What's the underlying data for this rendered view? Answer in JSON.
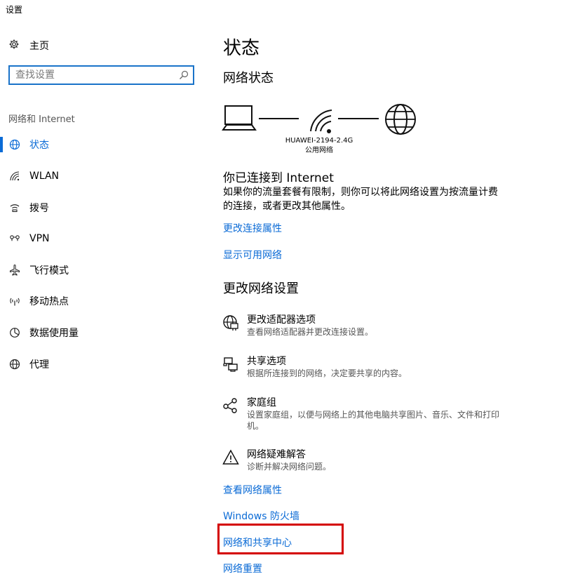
{
  "window": {
    "title": "设置"
  },
  "sidebar": {
    "home_label": "主页",
    "search_placeholder": "查找设置",
    "section_label": "网络和 Internet",
    "items": [
      {
        "label": "状态",
        "icon": "globe-status-icon",
        "active": true
      },
      {
        "label": "WLAN",
        "icon": "wifi-icon"
      },
      {
        "label": "拨号",
        "icon": "dialup-icon"
      },
      {
        "label": "VPN",
        "icon": "vpn-icon"
      },
      {
        "label": "飞行模式",
        "icon": "airplane-icon"
      },
      {
        "label": "移动热点",
        "icon": "hotspot-icon"
      },
      {
        "label": "数据使用量",
        "icon": "data-usage-icon"
      },
      {
        "label": "代理",
        "icon": "globe-icon"
      }
    ]
  },
  "main": {
    "title": "状态",
    "network_status_heading": "网络状态",
    "network": {
      "ssid": "HUAWEI-2194-2.4G",
      "type": "公用网络"
    },
    "connected_heading": "你已连接到 Internet",
    "connected_desc": "如果你的流量套餐有限制，则你可以将此网络设置为按流量计费的连接，或者更改其他属性。",
    "links_top": [
      "更改连接属性",
      "显示可用网络"
    ],
    "change_heading": "更改网络设置",
    "options": [
      {
        "title": "更改适配器选项",
        "desc": "查看网络适配器并更改连接设置。",
        "icon": "adapter-icon"
      },
      {
        "title": "共享选项",
        "desc": "根据所连接到的网络，决定要共享的内容。",
        "icon": "sharing-icon"
      },
      {
        "title": "家庭组",
        "desc": "设置家庭组，以便与网络上的其他电脑共享图片、音乐、文件和打印机。",
        "icon": "homegroup-icon"
      },
      {
        "title": "网络疑难解答",
        "desc": "诊断并解决网络问题。",
        "icon": "warning-icon"
      }
    ],
    "links_bottom": [
      "查看网络属性",
      "Windows 防火墙",
      "网络和共享中心",
      "网络重置"
    ]
  },
  "colors": {
    "accent": "#0b6bd6",
    "highlight": "#d40000"
  }
}
